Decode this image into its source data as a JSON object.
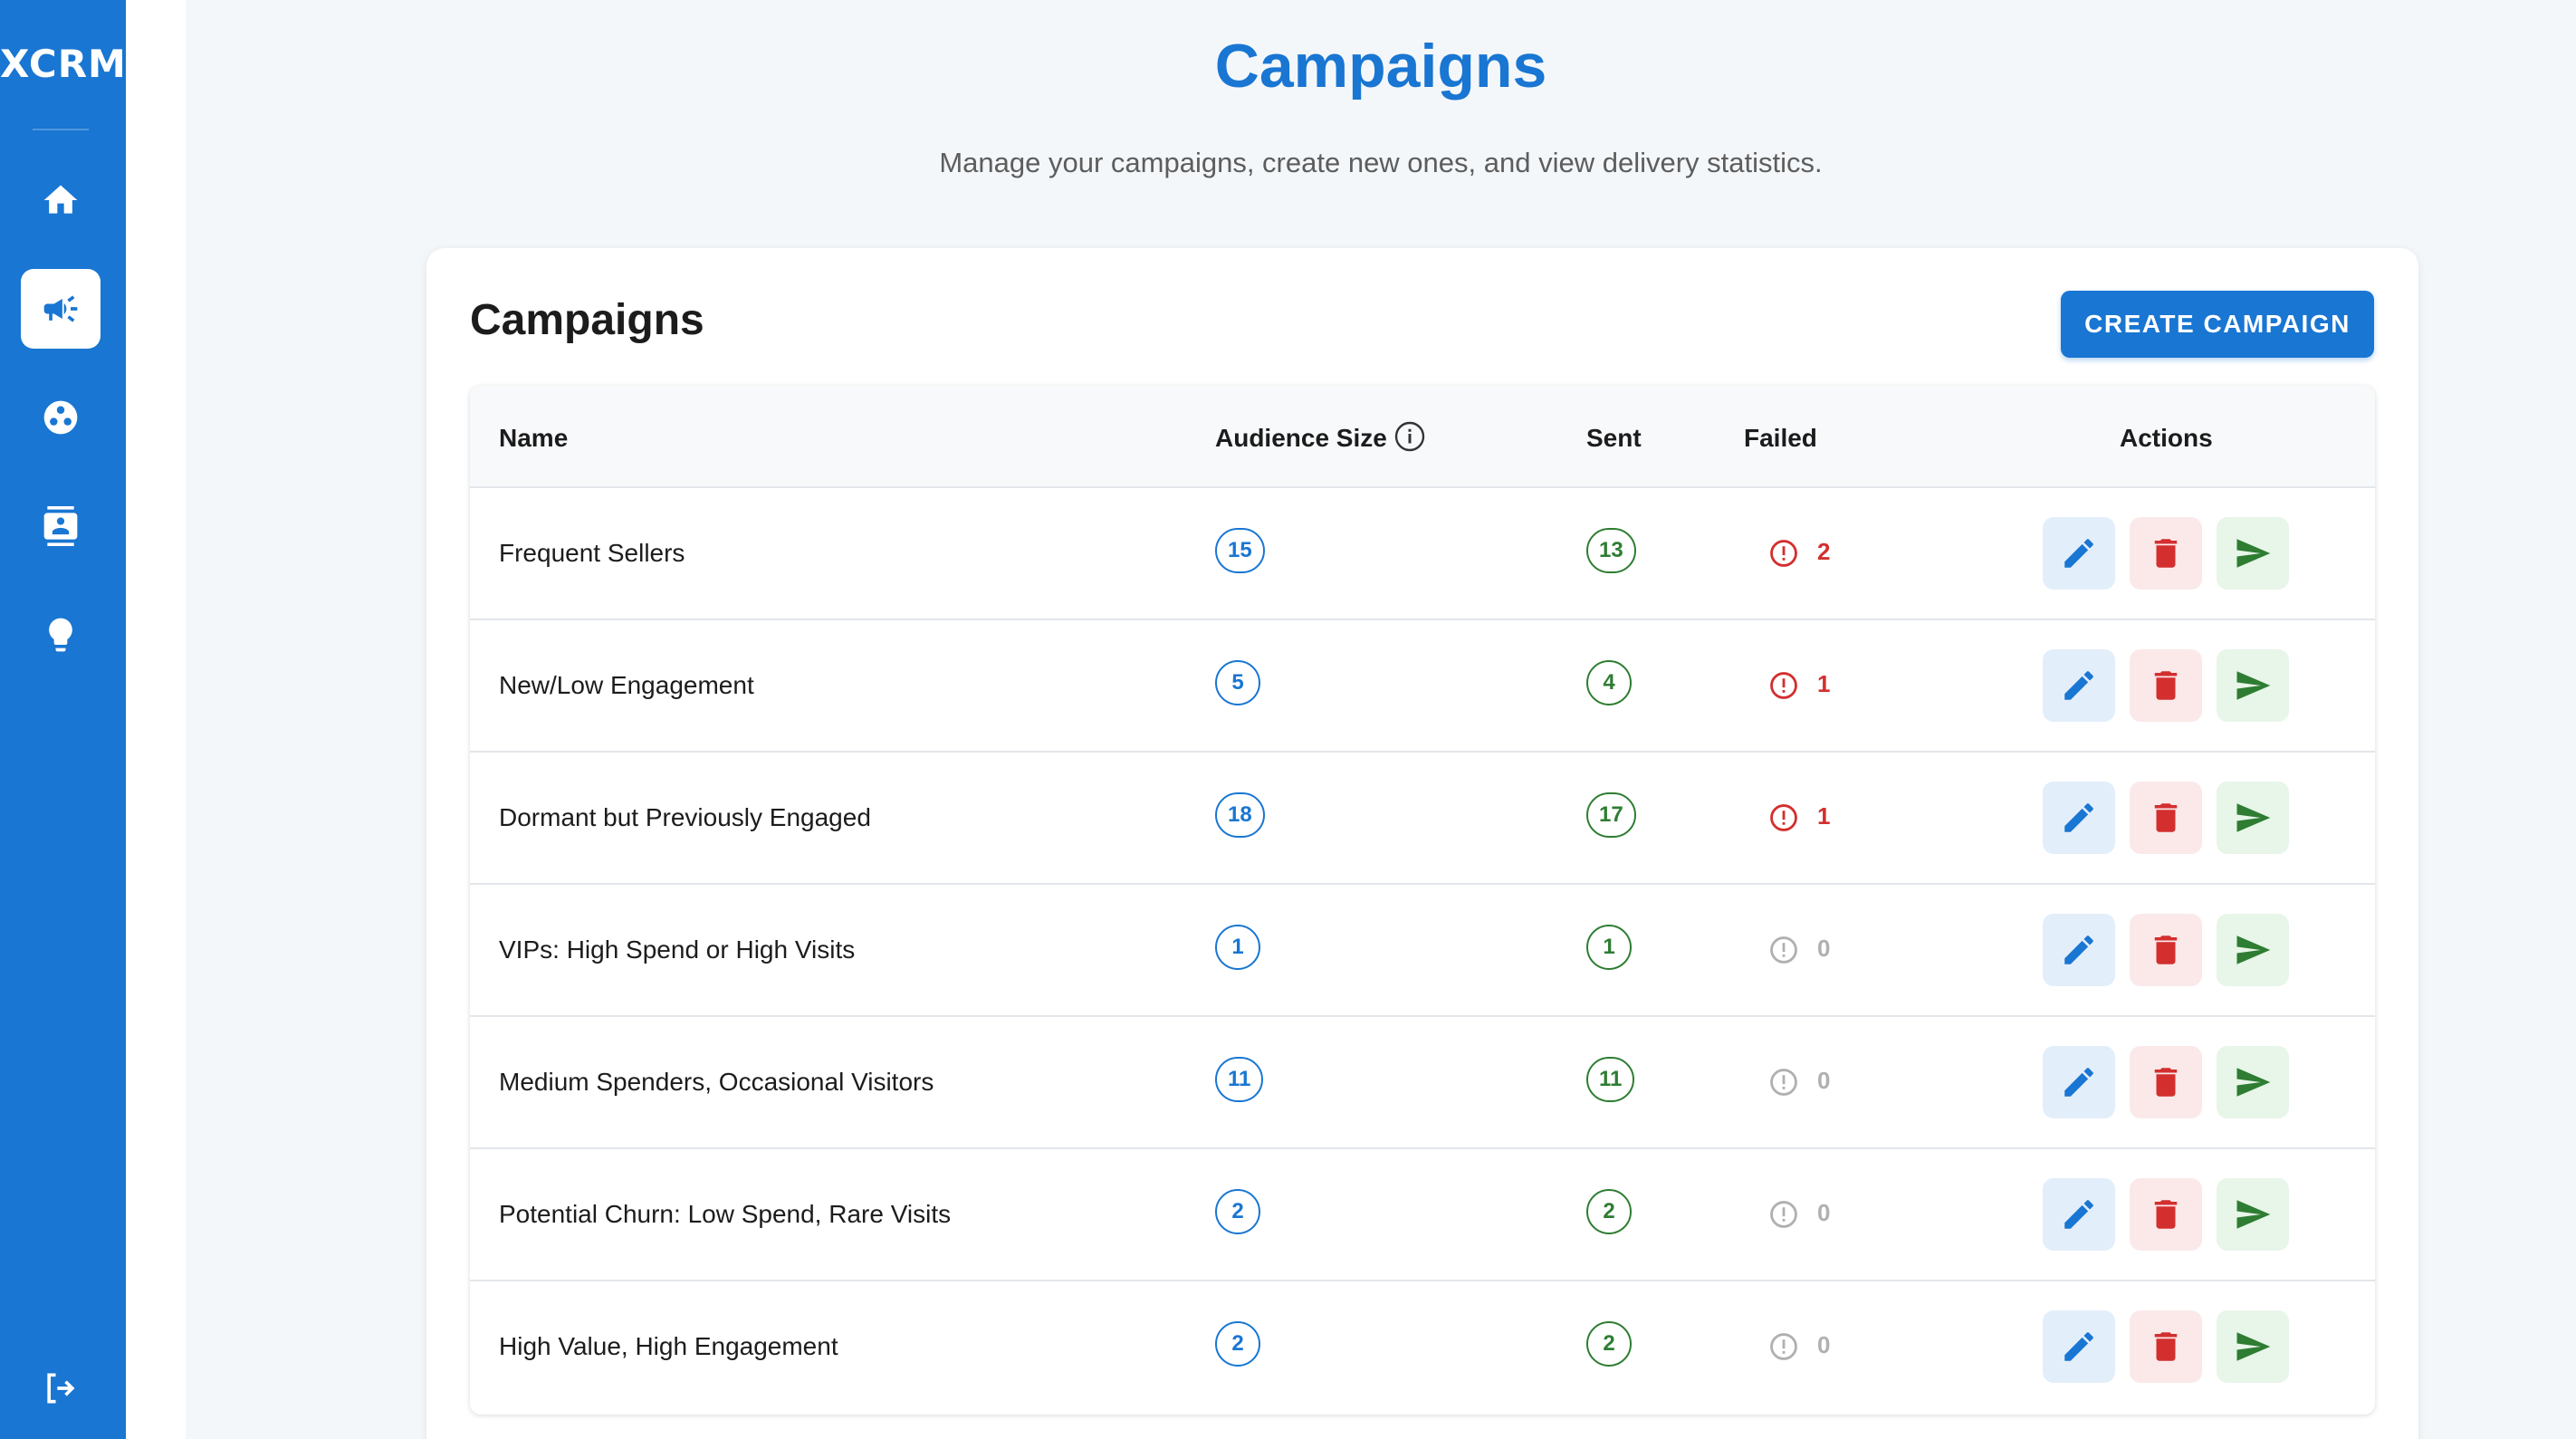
{
  "brand": "XCRM",
  "nav": [
    {
      "icon": "home-icon",
      "active": false
    },
    {
      "icon": "campaign-icon",
      "active": true
    },
    {
      "icon": "segments-icon",
      "active": false
    },
    {
      "icon": "contacts-icon",
      "active": false
    },
    {
      "icon": "insights-icon",
      "active": false
    }
  ],
  "logout_icon": "logout-icon",
  "header": {
    "title": "Campaigns",
    "subtitle": "Manage your campaigns, create new ones, and view delivery statistics."
  },
  "card": {
    "title": "Campaigns",
    "create_label": "CREATE CAMPAIGN"
  },
  "columns": {
    "name": "Name",
    "audience": "Audience Size",
    "sent": "Sent",
    "failed": "Failed",
    "actions": "Actions"
  },
  "rows": [
    {
      "name": "Frequent Sellers",
      "audience": "15",
      "sent": "13",
      "failed": "2"
    },
    {
      "name": "New/Low Engagement",
      "audience": "5",
      "sent": "4",
      "failed": "1"
    },
    {
      "name": "Dormant but Previously Engaged",
      "audience": "18",
      "sent": "17",
      "failed": "1"
    },
    {
      "name": "VIPs: High Spend or High Visits",
      "audience": "1",
      "sent": "1",
      "failed": "0"
    },
    {
      "name": "Medium Spenders, Occasional Visitors",
      "audience": "11",
      "sent": "11",
      "failed": "0"
    },
    {
      "name": "Potential Churn: Low Spend, Rare Visits",
      "audience": "2",
      "sent": "2",
      "failed": "0"
    },
    {
      "name": "High Value, High Engagement",
      "audience": "2",
      "sent": "2",
      "failed": "0"
    }
  ],
  "colors": {
    "primary": "#1976d2",
    "success": "#2e7d32",
    "error": "#d32f2f",
    "muted": "#b0b0b0"
  }
}
